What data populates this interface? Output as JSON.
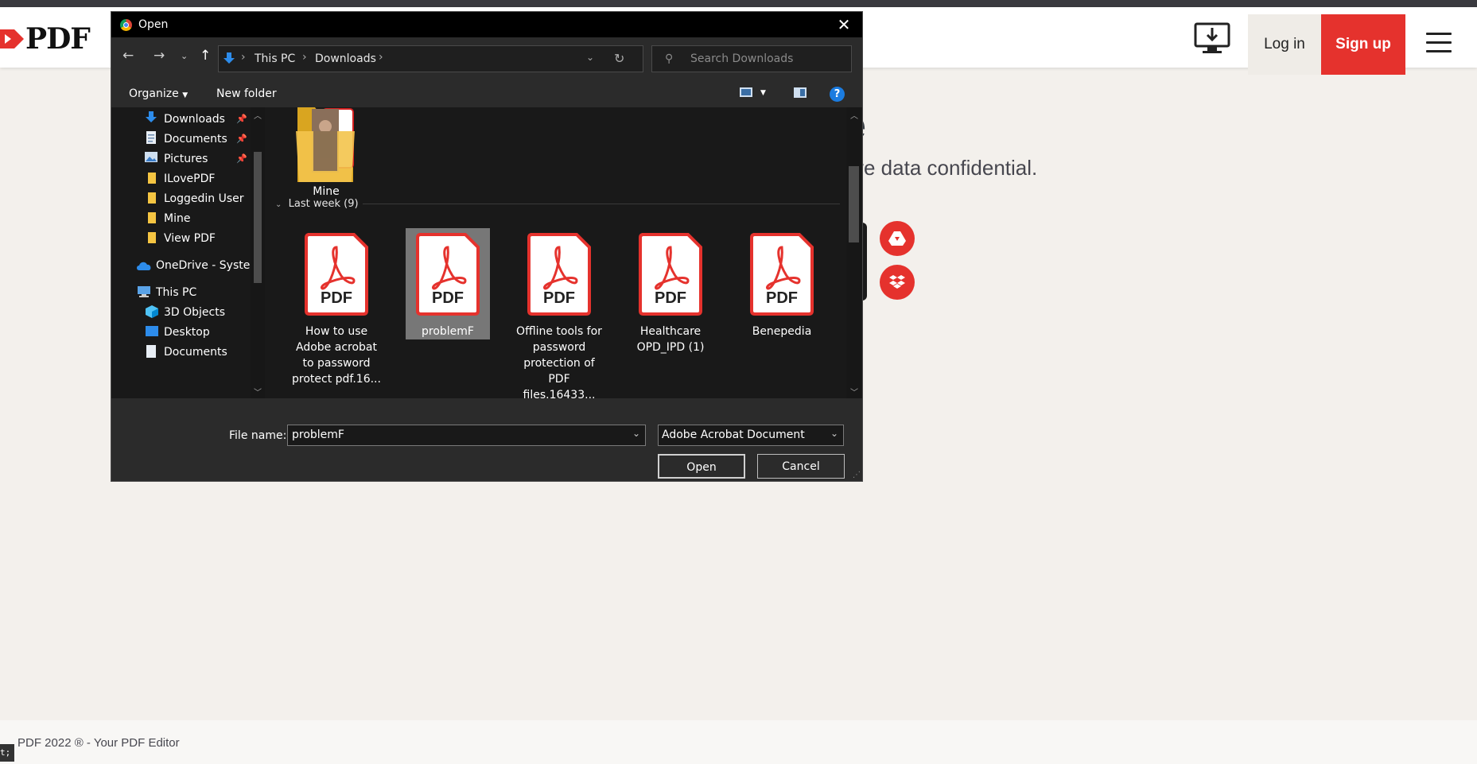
{
  "site": {
    "logo_text": "PDF",
    "login_label": "Log in",
    "signup_label": "Sign up",
    "hero_heading_fragment": "e",
    "hero_sub_fragment": "ve data confidential.",
    "footer_text": "PDF 2022 ® - Your PDF Editor",
    "corner_tip": "t;",
    "colors": {
      "brand": "#e5322d",
      "page_bg": "#f3f0ec"
    }
  },
  "dialog": {
    "title": "Open",
    "close_icon": "close-icon",
    "breadcrumbs": [
      "This PC",
      "Downloads"
    ],
    "search_placeholder": "Search Downloads",
    "toolbar": {
      "organize_label": "Organize",
      "new_folder_label": "New folder",
      "help_label": "?"
    },
    "nav_items": [
      {
        "label": "Downloads",
        "icon": "download-icon",
        "pinned": true
      },
      {
        "label": "Documents",
        "icon": "documents-icon",
        "pinned": true
      },
      {
        "label": "Pictures",
        "icon": "pictures-icon",
        "pinned": true
      },
      {
        "label": "ILovePDF",
        "icon": "folder-icon",
        "pinned": false
      },
      {
        "label": "Loggedin User",
        "icon": "folder-icon",
        "pinned": false
      },
      {
        "label": "Mine",
        "icon": "folder-icon",
        "pinned": false
      },
      {
        "label": "View PDF",
        "icon": "folder-icon",
        "pinned": false
      },
      {
        "label": "OneDrive - System",
        "icon": "cloud-icon",
        "pinned": false
      },
      {
        "label": "This PC",
        "icon": "computer-icon",
        "pinned": false
      },
      {
        "label": "3D Objects",
        "icon": "cube-icon",
        "pinned": false
      },
      {
        "label": "Desktop",
        "icon": "desktop-icon",
        "pinned": false
      },
      {
        "label": "Documents",
        "icon": "documents-icon",
        "pinned": false
      }
    ],
    "content": {
      "folder": {
        "label": "Mine"
      },
      "group_header": "Last week (9)",
      "files": [
        {
          "label": "How to use Adobe acrobat to password protect pdf.16...",
          "selected": false
        },
        {
          "label": "problemF",
          "selected": true
        },
        {
          "label": "Offline tools for password protection of PDF files.16433...",
          "selected": false
        },
        {
          "label": "Healthcare OPD_IPD (1)",
          "selected": false
        },
        {
          "label": "Benepedia",
          "selected": false
        }
      ],
      "pdf_icon_text": "PDF"
    },
    "bottom": {
      "file_name_label": "File name:",
      "file_name_value": "problemF",
      "file_type_value": "Adobe Acrobat Document",
      "open_label": "Open",
      "cancel_label": "Cancel"
    }
  }
}
